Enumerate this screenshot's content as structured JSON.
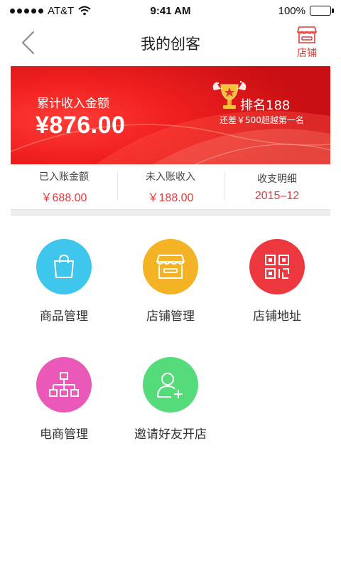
{
  "status_bar": {
    "carrier": "AT&T",
    "time": "9:41 AM",
    "battery": "100%"
  },
  "nav": {
    "title": "我的创客",
    "store_label": "店铺"
  },
  "banner": {
    "caption": "累计收入金额",
    "amount": "¥876.00",
    "rank": "排名188",
    "gap_text": "还差￥500超越第一名"
  },
  "stats": [
    {
      "label": "已入账金额",
      "value": "￥688.00"
    },
    {
      "label": "未入账收入",
      "value": "￥188.00"
    },
    {
      "label": "收支明细",
      "value": "2015–12"
    }
  ],
  "grid": [
    {
      "label": "商品管理",
      "icon": "shopping-bag-icon",
      "color": "#3fc6ec"
    },
    {
      "label": "店铺管理",
      "icon": "storefront-icon",
      "color": "#f3b324"
    },
    {
      "label": "店铺地址",
      "icon": "qr-code-icon",
      "color": "#ee3840"
    },
    {
      "label": "电商管理",
      "icon": "org-chart-icon",
      "color": "#ea58b8"
    },
    {
      "label": "邀请好友开店",
      "icon": "add-user-icon",
      "color": "#55db7a"
    }
  ],
  "colors": {
    "accent": "#e4393c",
    "banner_red": "#ee1f1f"
  }
}
